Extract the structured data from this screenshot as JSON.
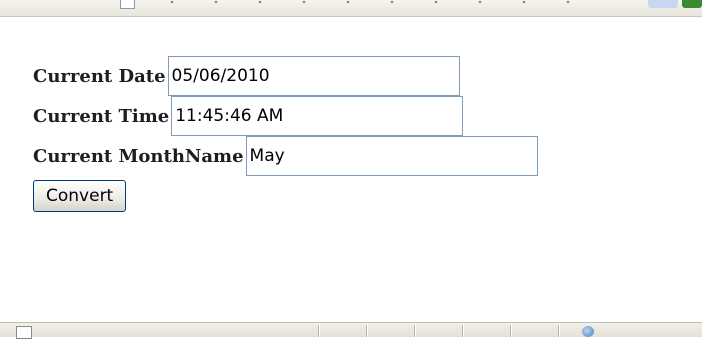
{
  "form": {
    "date_label": "Current Date",
    "date_value": "05/06/2010",
    "time_label": "Current Time",
    "time_value": "11:45:46 AM",
    "month_label": "Current MonthName",
    "month_value": "May",
    "convert_label": "Convert"
  },
  "icons": {
    "top_checkbox": "checkbox-icon",
    "status_page": "page-icon",
    "status_zone": "globe-icon"
  },
  "colors": {
    "field_border": "#7f9db9",
    "button_border": "#003c74",
    "label_text": "#1e1e1e"
  }
}
